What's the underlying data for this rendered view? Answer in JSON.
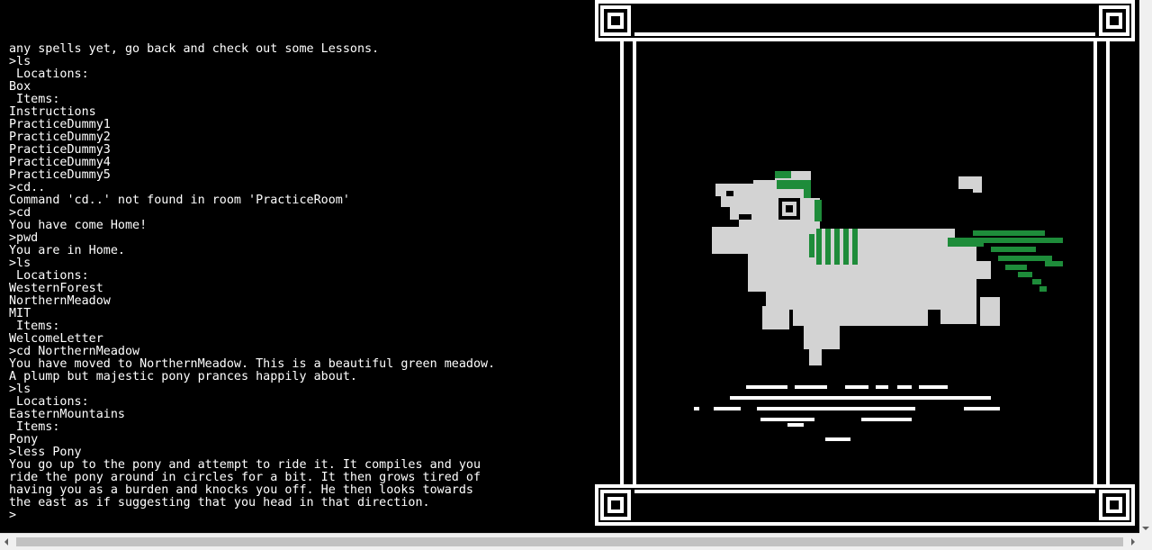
{
  "terminal": {
    "lines": [
      "any spells yet, go back and check out some Lessons.",
      ">ls",
      " Locations:",
      "Box",
      " Items:",
      "Instructions",
      "PracticeDummy1",
      "PracticeDummy2",
      "PracticeDummy3",
      "PracticeDummy4",
      "PracticeDummy5",
      ">cd..",
      "Command 'cd..' not found in room 'PracticeRoom'",
      ">cd",
      "You have come Home!",
      ">pwd",
      "You are in Home.",
      ">ls",
      " Locations:",
      "WesternForest",
      "NorthernMeadow",
      "MIT",
      " Items:",
      "WelcomeLetter",
      ">cd NorthernMeadow",
      "You have moved to NorthernMeadow. This is a beautiful green meadow.",
      "A plump but majestic pony prances happily about.",
      ">ls",
      " Locations:",
      "EasternMountains",
      " Items:",
      "Pony",
      ">less Pony",
      "You go up to the pony and attempt to ride it. It compiles and you",
      "ride the pony around in circles for a bit. It then grows tired of",
      "having you as a burden and knocks you off. He then looks towards",
      "the east as if suggesting that you head in that direction.",
      ">"
    ]
  },
  "art": {
    "subject": "pony-pixel-art",
    "colors": {
      "frame": "#ffffff",
      "body": "#d3d3d3",
      "mane": "#1e8c3a",
      "background": "#000000"
    }
  },
  "scrollbars": {
    "colors": {
      "track": "#f0f0f0",
      "thumb": "#c2c2c2"
    }
  }
}
